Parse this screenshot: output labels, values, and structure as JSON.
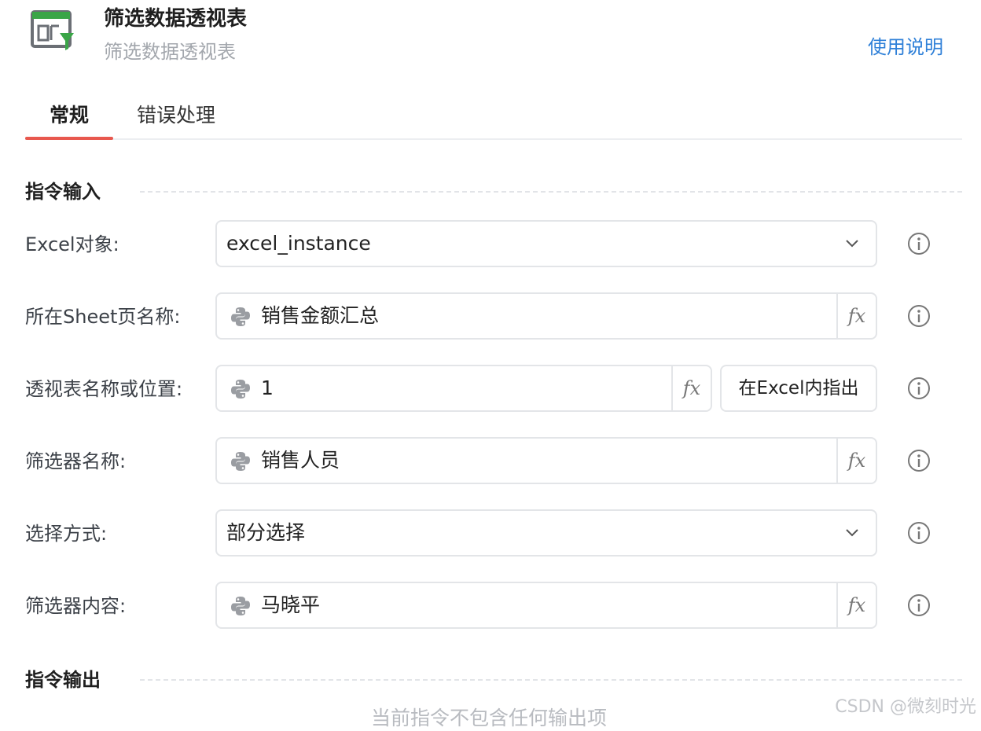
{
  "header": {
    "title": "筛选数据透视表",
    "subtitle": "筛选数据透视表",
    "help_link": "使用说明"
  },
  "tabs": [
    {
      "label": "常规",
      "active": true
    },
    {
      "label": "错误处理",
      "active": false
    }
  ],
  "sections": {
    "input_title": "指令输入",
    "output_title": "指令输出"
  },
  "fields": {
    "excel_object": {
      "label": "Excel对象:",
      "value": "excel_instance",
      "type": "select"
    },
    "sheet_name": {
      "label": "所在Sheet页名称:",
      "value": "销售金额汇总",
      "type": "expression"
    },
    "pivot_name": {
      "label": "透视表名称或位置:",
      "value": "1",
      "type": "expression",
      "button_label": "在Excel内指出"
    },
    "filter_name": {
      "label": "筛选器名称:",
      "value": "销售人员",
      "type": "expression"
    },
    "select_mode": {
      "label": "选择方式:",
      "value": "部分选择",
      "type": "select"
    },
    "filter_content": {
      "label": "筛选器内容:",
      "value": "马晓平",
      "type": "expression"
    }
  },
  "fx_label": "fx",
  "output_empty_text": "当前指令不包含任何输出项",
  "watermark": "CSDN @微刻时光",
  "colors": {
    "accent_tab": "#e8584e",
    "link": "#2f80d8",
    "icon_green": "#3aa547"
  },
  "icons": {
    "header": "pivot-filter-icon",
    "python": "python-icon",
    "info": "info-icon",
    "dropdown": "chevron-down-icon"
  }
}
